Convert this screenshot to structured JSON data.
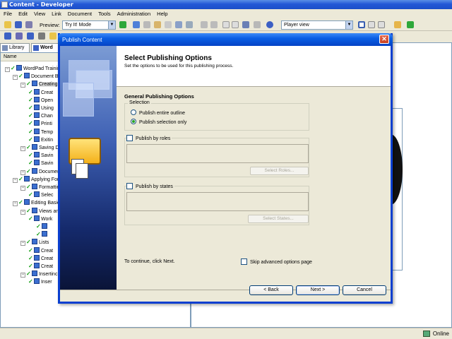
{
  "window": {
    "title": "Content - Developer"
  },
  "menu": [
    "File",
    "Edit",
    "View",
    "Link",
    "Document",
    "Tools",
    "Administration",
    "Help"
  ],
  "toolbar": {
    "preview_label": "Preview:",
    "preview_mode": "Try It! Mode",
    "player_view": "Player view"
  },
  "left_panel": {
    "tabs": [
      "Library",
      "Word"
    ],
    "column_header": "Name",
    "tree": [
      {
        "label": "WordPad Training",
        "level": 0
      },
      {
        "label": "Document Ba",
        "level": 1
      },
      {
        "label": "Creating",
        "level": 2,
        "selected": true
      },
      {
        "label": "Creat",
        "level": 3
      },
      {
        "label": "Open",
        "level": 3
      },
      {
        "label": "Using",
        "level": 3
      },
      {
        "label": "Chan",
        "level": 3
      },
      {
        "label": "Printi",
        "level": 3
      },
      {
        "label": "Temp",
        "level": 3
      },
      {
        "label": "Exitin",
        "level": 3
      },
      {
        "label": "Saving D",
        "level": 2
      },
      {
        "label": "Savin",
        "level": 3
      },
      {
        "label": "Savin",
        "level": 3
      },
      {
        "label": "Documen",
        "level": 2
      },
      {
        "label": "Applying For",
        "level": 1
      },
      {
        "label": "Formattir",
        "level": 2
      },
      {
        "label": "Selec",
        "level": 3
      },
      {
        "label": "Editing Basic",
        "level": 1
      },
      {
        "label": "Views an",
        "level": 2
      },
      {
        "label": "Work",
        "level": 3
      },
      {
        "label": "",
        "level": 4
      },
      {
        "label": "",
        "level": 4
      },
      {
        "label": "Lists",
        "level": 2
      },
      {
        "label": "Creat",
        "level": 3
      },
      {
        "label": "Creat",
        "level": 3
      },
      {
        "label": "Creat",
        "level": 3
      },
      {
        "label": "Insertinc",
        "level": 2
      },
      {
        "label": "Inser",
        "level": 3
      }
    ]
  },
  "dialog": {
    "title": "Publish Content",
    "header_title": "Select Publishing Options",
    "header_subtitle": "Set the options to be used for this publishing process.",
    "general_group": "General Publishing Options",
    "selection_label": "Selection",
    "radio_entire": "Publish entire outline",
    "radio_selection": "Publish selection only",
    "selected_radio": "selection",
    "roles_check": "Publish by roles",
    "select_roles": "Select Roles...",
    "states_check": "Publish by states",
    "select_states": "Select States...",
    "continue_text": "To continue, click Next.",
    "skip_advanced": "Skip advanced options page",
    "back_button": "< Back",
    "next_button": "Next >",
    "cancel_button": "Cancel",
    "close_glyph": "✕"
  },
  "status": {
    "online": "Online"
  },
  "colors": {
    "titlebar_blue": "#2358d6",
    "dialog_border": "#0a3fd0",
    "check_green": "#18a018",
    "dialog_face": "#ece9d8"
  }
}
